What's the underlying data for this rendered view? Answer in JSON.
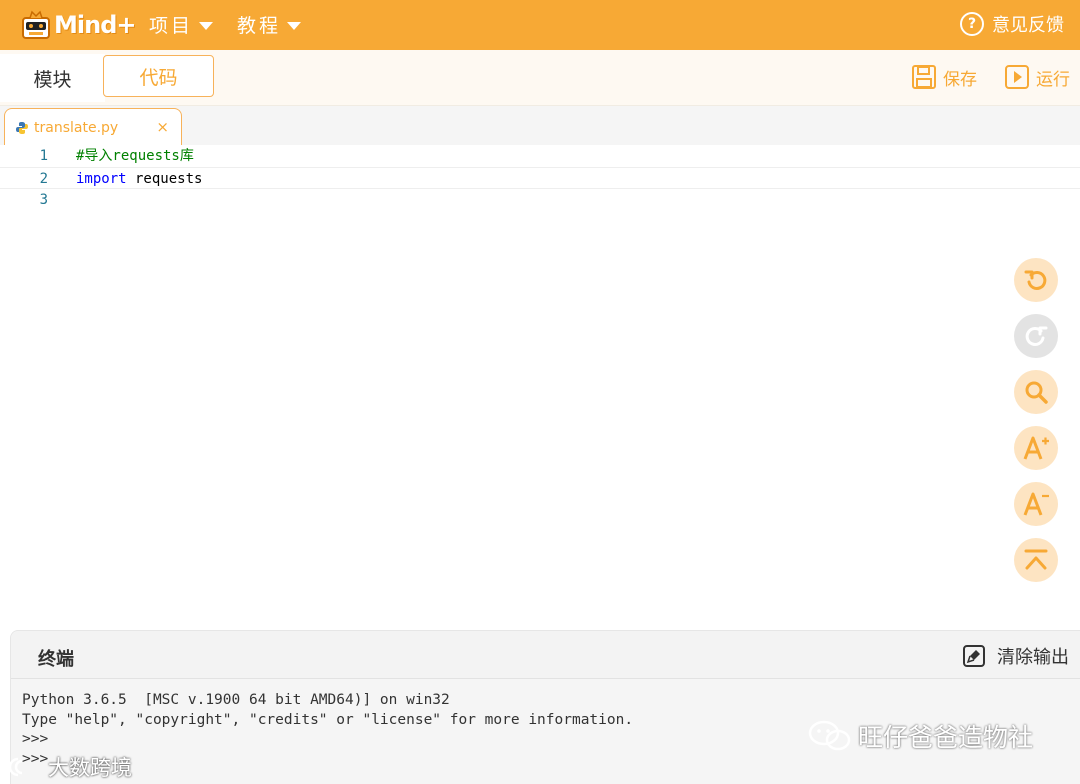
{
  "header": {
    "logo_text": "Mind+",
    "menu_project": "项目",
    "menu_tutorial": "教程",
    "feedback": "意见反馈"
  },
  "modebar": {
    "tab_blocks": "模块",
    "tab_code": "代码",
    "save": "保存",
    "run": "运行"
  },
  "file_tab": {
    "name": "translate.py",
    "close": "×"
  },
  "editor": {
    "lines": [
      {
        "num": "1",
        "text": "#导入requests库"
      },
      {
        "num": "2",
        "keyword": "import",
        "rest": " requests"
      },
      {
        "num": "3",
        "text": ""
      }
    ]
  },
  "side_tools": [
    "undo-icon",
    "redo-icon",
    "search-icon",
    "font-increase-icon",
    "font-decrease-icon",
    "scroll-top-icon"
  ],
  "terminal": {
    "title": "终端",
    "clear": "清除输出",
    "lines": [
      "Python 3.6.5  [MSC v.1900 64 bit AMD64)] on win32",
      "Type \"help\", \"copyright\", \"credits\" or \"license\" for more information.",
      ">>>",
      ">>>"
    ]
  },
  "watermarks": {
    "right": "旺仔爸爸造物社",
    "left": "大数跨境"
  },
  "colors": {
    "accent": "#f7a935",
    "tool_bg": "#fde4c2",
    "tool_disabled": "#e3e3e3"
  }
}
